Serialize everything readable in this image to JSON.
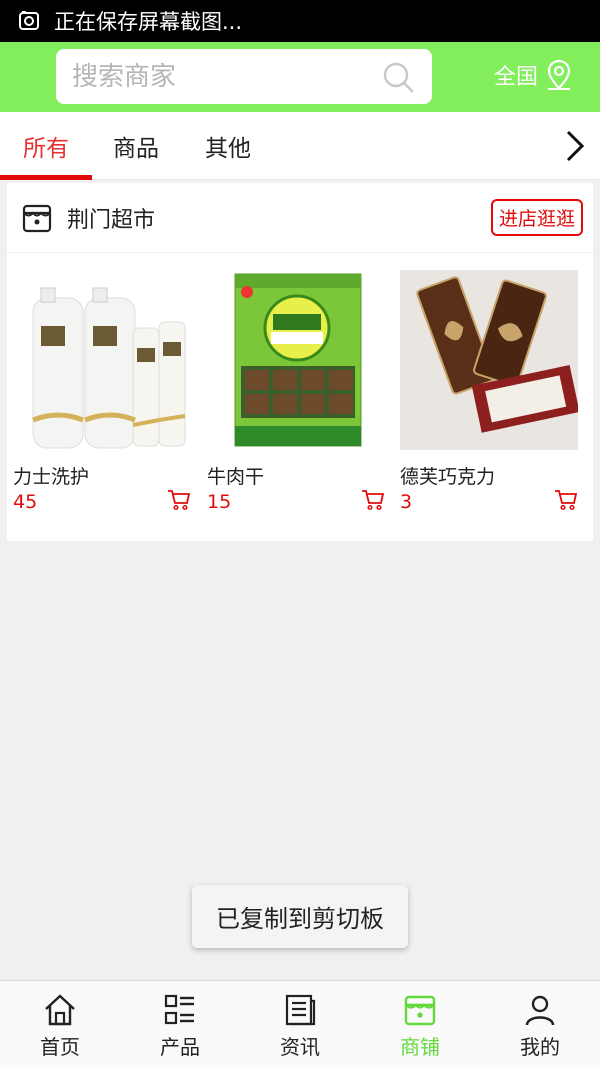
{
  "status_bar": {
    "text": "正在保存屏幕截图..."
  },
  "search": {
    "placeholder": "搜索商家"
  },
  "region": {
    "label": "全国"
  },
  "tabs": [
    {
      "label": "所有",
      "active": true
    },
    {
      "label": "商品",
      "active": false
    },
    {
      "label": "其他",
      "active": false
    }
  ],
  "shop": {
    "name": "荆门超市",
    "enter_label": "进店逛逛",
    "products": [
      {
        "name": "力士洗护",
        "price": "45"
      },
      {
        "name": "牛肉干",
        "price": "15"
      },
      {
        "name": "德芙巧克力",
        "price": "3"
      }
    ]
  },
  "toast": {
    "text": "已复制到剪切板"
  },
  "bottom_nav": [
    {
      "label": "首页",
      "icon": "home-icon"
    },
    {
      "label": "产品",
      "icon": "grid-list-icon"
    },
    {
      "label": "资讯",
      "icon": "news-icon"
    },
    {
      "label": "商铺",
      "icon": "shop-icon",
      "active": true
    },
    {
      "label": "我的",
      "icon": "user-icon"
    }
  ],
  "colors": {
    "header_green": "#82ee5b",
    "accent_red": "#e20b0b",
    "active_green": "#62d83c"
  }
}
